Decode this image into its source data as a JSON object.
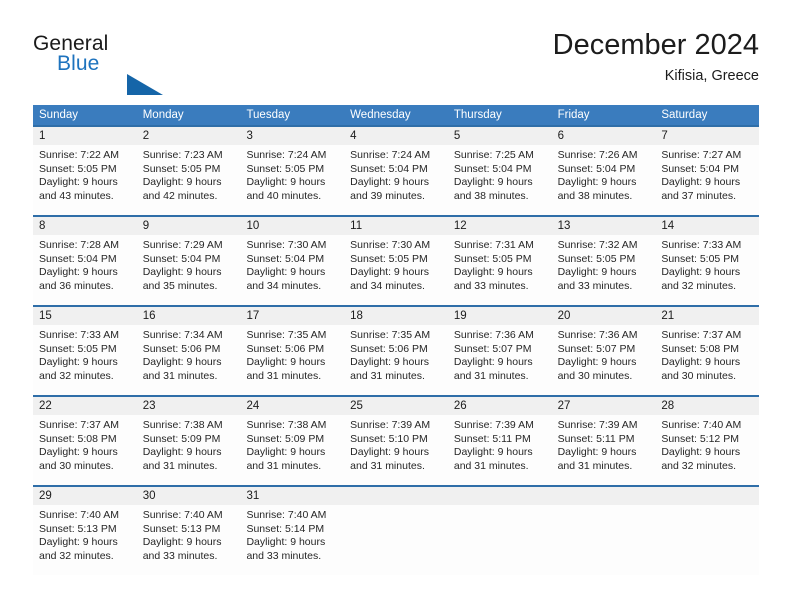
{
  "brand": {
    "word_one": "General",
    "word_two": "Blue",
    "logo_icon": "triangle-flag-icon"
  },
  "header": {
    "title": "December 2024",
    "subtitle": "Kifisia, Greece"
  },
  "colors": {
    "header_blue": "#3a7cbe",
    "rule_blue": "#2f6ea8",
    "brand_blue": "#1e73be",
    "date_band": "#f0f0f0",
    "text": "#262626"
  },
  "weekdays": [
    "Sunday",
    "Monday",
    "Tuesday",
    "Wednesday",
    "Thursday",
    "Friday",
    "Saturday"
  ],
  "weeks": [
    {
      "days": [
        {
          "num": "1",
          "l1": "Sunrise: 7:22 AM",
          "l2": "Sunset: 5:05 PM",
          "l3": "Daylight: 9 hours",
          "l4": "and 43 minutes."
        },
        {
          "num": "2",
          "l1": "Sunrise: 7:23 AM",
          "l2": "Sunset: 5:05 PM",
          "l3": "Daylight: 9 hours",
          "l4": "and 42 minutes."
        },
        {
          "num": "3",
          "l1": "Sunrise: 7:24 AM",
          "l2": "Sunset: 5:05 PM",
          "l3": "Daylight: 9 hours",
          "l4": "and 40 minutes."
        },
        {
          "num": "4",
          "l1": "Sunrise: 7:24 AM",
          "l2": "Sunset: 5:04 PM",
          "l3": "Daylight: 9 hours",
          "l4": "and 39 minutes."
        },
        {
          "num": "5",
          "l1": "Sunrise: 7:25 AM",
          "l2": "Sunset: 5:04 PM",
          "l3": "Daylight: 9 hours",
          "l4": "and 38 minutes."
        },
        {
          "num": "6",
          "l1": "Sunrise: 7:26 AM",
          "l2": "Sunset: 5:04 PM",
          "l3": "Daylight: 9 hours",
          "l4": "and 38 minutes."
        },
        {
          "num": "7",
          "l1": "Sunrise: 7:27 AM",
          "l2": "Sunset: 5:04 PM",
          "l3": "Daylight: 9 hours",
          "l4": "and 37 minutes."
        }
      ]
    },
    {
      "days": [
        {
          "num": "8",
          "l1": "Sunrise: 7:28 AM",
          "l2": "Sunset: 5:04 PM",
          "l3": "Daylight: 9 hours",
          "l4": "and 36 minutes."
        },
        {
          "num": "9",
          "l1": "Sunrise: 7:29 AM",
          "l2": "Sunset: 5:04 PM",
          "l3": "Daylight: 9 hours",
          "l4": "and 35 minutes."
        },
        {
          "num": "10",
          "l1": "Sunrise: 7:30 AM",
          "l2": "Sunset: 5:04 PM",
          "l3": "Daylight: 9 hours",
          "l4": "and 34 minutes."
        },
        {
          "num": "11",
          "l1": "Sunrise: 7:30 AM",
          "l2": "Sunset: 5:05 PM",
          "l3": "Daylight: 9 hours",
          "l4": "and 34 minutes."
        },
        {
          "num": "12",
          "l1": "Sunrise: 7:31 AM",
          "l2": "Sunset: 5:05 PM",
          "l3": "Daylight: 9 hours",
          "l4": "and 33 minutes."
        },
        {
          "num": "13",
          "l1": "Sunrise: 7:32 AM",
          "l2": "Sunset: 5:05 PM",
          "l3": "Daylight: 9 hours",
          "l4": "and 33 minutes."
        },
        {
          "num": "14",
          "l1": "Sunrise: 7:33 AM",
          "l2": "Sunset: 5:05 PM",
          "l3": "Daylight: 9 hours",
          "l4": "and 32 minutes."
        }
      ]
    },
    {
      "days": [
        {
          "num": "15",
          "l1": "Sunrise: 7:33 AM",
          "l2": "Sunset: 5:05 PM",
          "l3": "Daylight: 9 hours",
          "l4": "and 32 minutes."
        },
        {
          "num": "16",
          "l1": "Sunrise: 7:34 AM",
          "l2": "Sunset: 5:06 PM",
          "l3": "Daylight: 9 hours",
          "l4": "and 31 minutes."
        },
        {
          "num": "17",
          "l1": "Sunrise: 7:35 AM",
          "l2": "Sunset: 5:06 PM",
          "l3": "Daylight: 9 hours",
          "l4": "and 31 minutes."
        },
        {
          "num": "18",
          "l1": "Sunrise: 7:35 AM",
          "l2": "Sunset: 5:06 PM",
          "l3": "Daylight: 9 hours",
          "l4": "and 31 minutes."
        },
        {
          "num": "19",
          "l1": "Sunrise: 7:36 AM",
          "l2": "Sunset: 5:07 PM",
          "l3": "Daylight: 9 hours",
          "l4": "and 31 minutes."
        },
        {
          "num": "20",
          "l1": "Sunrise: 7:36 AM",
          "l2": "Sunset: 5:07 PM",
          "l3": "Daylight: 9 hours",
          "l4": "and 30 minutes."
        },
        {
          "num": "21",
          "l1": "Sunrise: 7:37 AM",
          "l2": "Sunset: 5:08 PM",
          "l3": "Daylight: 9 hours",
          "l4": "and 30 minutes."
        }
      ]
    },
    {
      "days": [
        {
          "num": "22",
          "l1": "Sunrise: 7:37 AM",
          "l2": "Sunset: 5:08 PM",
          "l3": "Daylight: 9 hours",
          "l4": "and 30 minutes."
        },
        {
          "num": "23",
          "l1": "Sunrise: 7:38 AM",
          "l2": "Sunset: 5:09 PM",
          "l3": "Daylight: 9 hours",
          "l4": "and 31 minutes."
        },
        {
          "num": "24",
          "l1": "Sunrise: 7:38 AM",
          "l2": "Sunset: 5:09 PM",
          "l3": "Daylight: 9 hours",
          "l4": "and 31 minutes."
        },
        {
          "num": "25",
          "l1": "Sunrise: 7:39 AM",
          "l2": "Sunset: 5:10 PM",
          "l3": "Daylight: 9 hours",
          "l4": "and 31 minutes."
        },
        {
          "num": "26",
          "l1": "Sunrise: 7:39 AM",
          "l2": "Sunset: 5:11 PM",
          "l3": "Daylight: 9 hours",
          "l4": "and 31 minutes."
        },
        {
          "num": "27",
          "l1": "Sunrise: 7:39 AM",
          "l2": "Sunset: 5:11 PM",
          "l3": "Daylight: 9 hours",
          "l4": "and 31 minutes."
        },
        {
          "num": "28",
          "l1": "Sunrise: 7:40 AM",
          "l2": "Sunset: 5:12 PM",
          "l3": "Daylight: 9 hours",
          "l4": "and 32 minutes."
        }
      ]
    },
    {
      "days": [
        {
          "num": "29",
          "l1": "Sunrise: 7:40 AM",
          "l2": "Sunset: 5:13 PM",
          "l3": "Daylight: 9 hours",
          "l4": "and 32 minutes."
        },
        {
          "num": "30",
          "l1": "Sunrise: 7:40 AM",
          "l2": "Sunset: 5:13 PM",
          "l3": "Daylight: 9 hours",
          "l4": "and 33 minutes."
        },
        {
          "num": "31",
          "l1": "Sunrise: 7:40 AM",
          "l2": "Sunset: 5:14 PM",
          "l3": "Daylight: 9 hours",
          "l4": "and 33 minutes."
        },
        {
          "num": "",
          "l1": "",
          "l2": "",
          "l3": "",
          "l4": ""
        },
        {
          "num": "",
          "l1": "",
          "l2": "",
          "l3": "",
          "l4": ""
        },
        {
          "num": "",
          "l1": "",
          "l2": "",
          "l3": "",
          "l4": ""
        },
        {
          "num": "",
          "l1": "",
          "l2": "",
          "l3": "",
          "l4": ""
        }
      ]
    }
  ]
}
